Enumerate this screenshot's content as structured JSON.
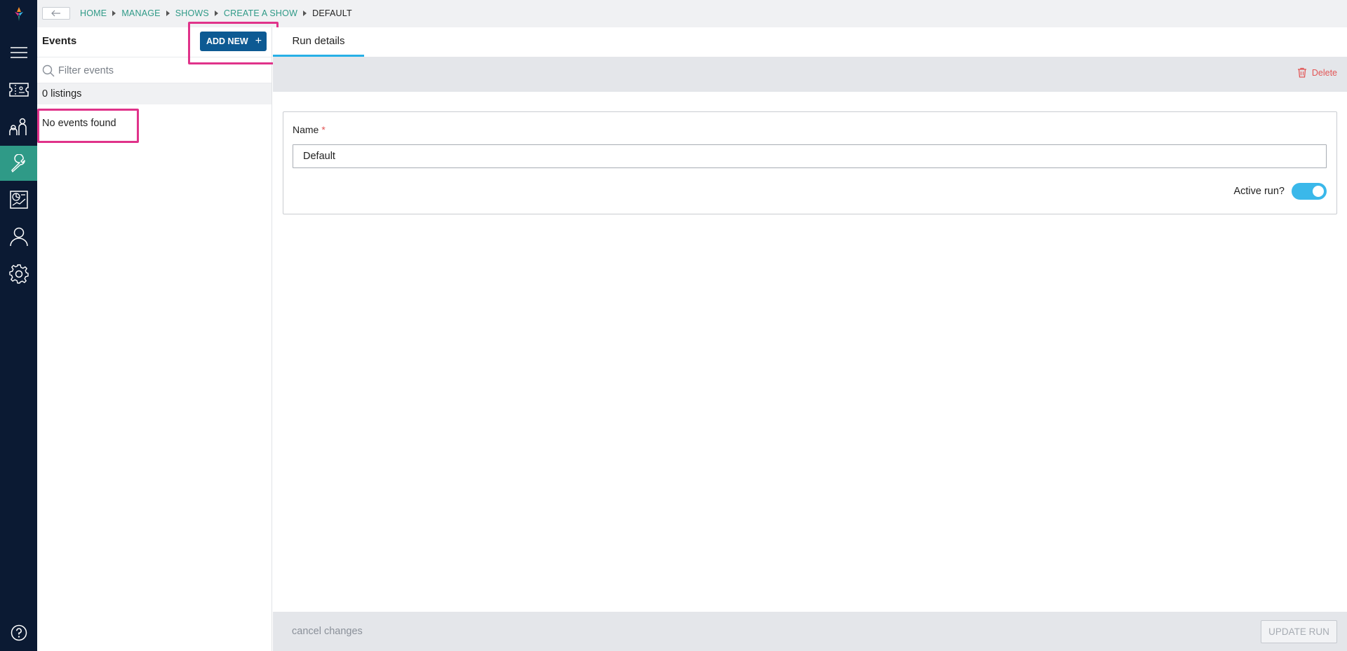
{
  "nav": {
    "items": [
      {
        "icon": "logo-icon",
        "active": false
      },
      {
        "icon": "menu-icon",
        "active": false
      },
      {
        "icon": "ticket-icon",
        "active": false
      },
      {
        "icon": "customers-icon",
        "active": false
      },
      {
        "icon": "wrench-icon",
        "active": true
      },
      {
        "icon": "reports-icon",
        "active": false
      },
      {
        "icon": "user-icon",
        "active": false
      },
      {
        "icon": "gear-icon",
        "active": false
      },
      {
        "icon": "help-icon",
        "active": false
      }
    ]
  },
  "breadcrumb": {
    "items": [
      "HOME",
      "MANAGE",
      "SHOWS",
      "CREATE A SHOW",
      "DEFAULT"
    ]
  },
  "events_panel": {
    "title": "Events",
    "add_new_label": "ADD NEW",
    "filter_placeholder": "Filter events",
    "listings_count": "0 listings",
    "empty_message": "No events found"
  },
  "tabs": {
    "run_details": "Run details"
  },
  "toolbar": {
    "delete_label": "Delete"
  },
  "form": {
    "name_label": "Name",
    "required_mark": "*",
    "name_value": "Default",
    "active_label": "Active run?",
    "active_value": true
  },
  "footer": {
    "cancel_label": "cancel changes",
    "update_label": "UPDATE RUN"
  },
  "colors": {
    "nav_bg": "#0b1a33",
    "nav_active": "#2f9a87",
    "breadcrumb_link": "#2f9a87",
    "primary_button": "#0d5a93",
    "tab_underline": "#27b0e6",
    "toggle_on": "#3ab8ea",
    "delete": "#e25555",
    "highlight": "#e0338a"
  }
}
